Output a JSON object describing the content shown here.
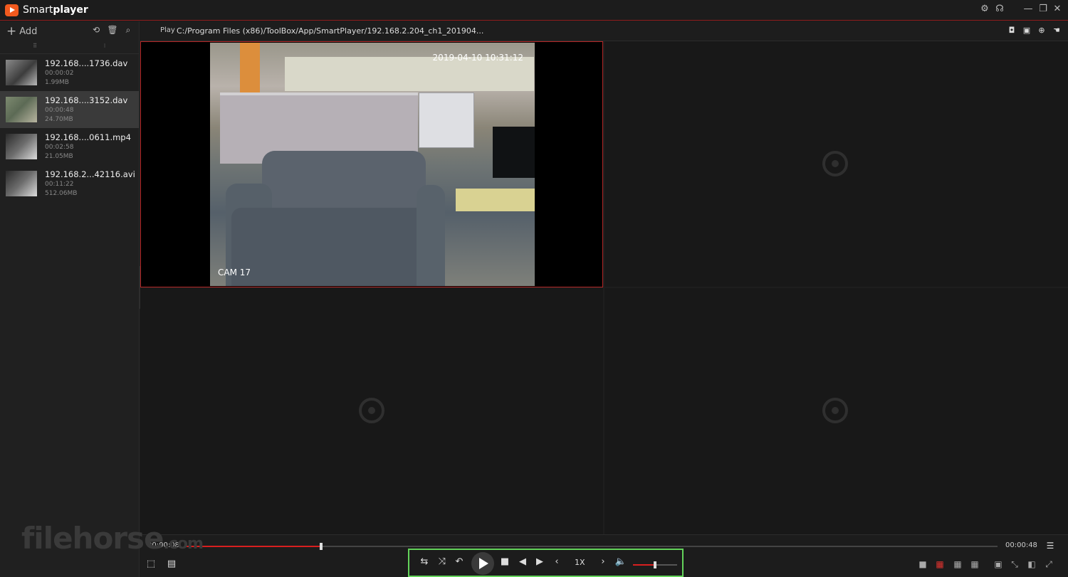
{
  "app": {
    "name_prefix": "Smart",
    "name_bold": "player"
  },
  "sidebar": {
    "add_label": "Add",
    "files": [
      {
        "name": "192.168....1736.dav",
        "duration": "00:00:02",
        "size": "1.99MB"
      },
      {
        "name": "192.168....3152.dav",
        "duration": "00:00:48",
        "size": "24.70MB"
      },
      {
        "name": "192.168....0611.mp4",
        "duration": "00:02:58",
        "size": "21.05MB"
      },
      {
        "name": "192.168.2...42116.avi",
        "duration": "00:11:22",
        "size": "512.06MB"
      }
    ]
  },
  "pathbar": {
    "label": "Play",
    "path": "C:/Program Files (x86)/ToolBox/App/SmartPlayer/192.168.2.204_ch1_201904..."
  },
  "video": {
    "timestamp": "2019-04-10 10:31:12",
    "camera": "CAM 17"
  },
  "playback": {
    "current_time": "00:00:08",
    "total_time": "00:00:48",
    "progress": 0.167,
    "speed": "1X",
    "volume": 0.5
  },
  "watermark": {
    "text": "filehorse",
    "suffix": ".com"
  },
  "colors": {
    "accent": "#d81f1f",
    "highlight_frame": "#63d35a",
    "logo": "#f25a1e"
  },
  "icons": {
    "settings": "gear-icon",
    "support": "headset-icon",
    "minimize": "minimize-icon",
    "restore": "restore-icon",
    "close": "close-icon",
    "snapshot": "camera-icon",
    "chat": "chat-icon",
    "zoom": "zoom-icon",
    "hand": "hand-icon"
  }
}
